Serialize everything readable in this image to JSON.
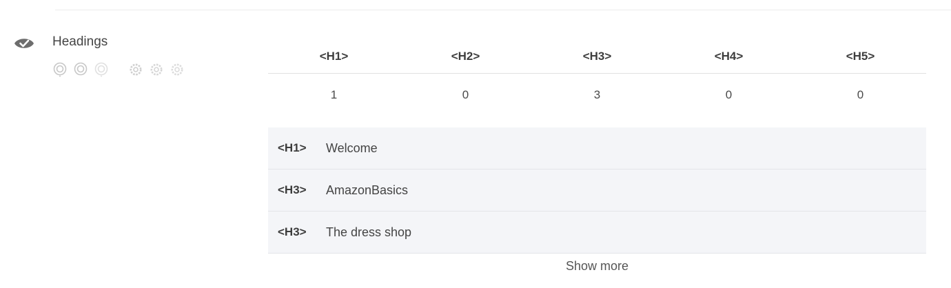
{
  "section": {
    "title": "Headings",
    "status_icon": "eye-check-icon",
    "status_color": "#6d6d6d",
    "view_icons": [
      "target-icon",
      "target-icon",
      "target-icon"
    ],
    "settings_icons": [
      "gear-icon",
      "gear-icon",
      "gear-icon"
    ]
  },
  "summary": {
    "headers": [
      "<H1>",
      "<H2>",
      "<H3>",
      "<H4>",
      "<H5>"
    ],
    "counts": [
      "1",
      "0",
      "3",
      "0",
      "0"
    ]
  },
  "headings": [
    {
      "tag": "<H1>",
      "text": "Welcome"
    },
    {
      "tag": "<H3>",
      "text": "AmazonBasics"
    },
    {
      "tag": "<H3>",
      "text": "The dress shop"
    }
  ],
  "show_more_label": "Show more"
}
